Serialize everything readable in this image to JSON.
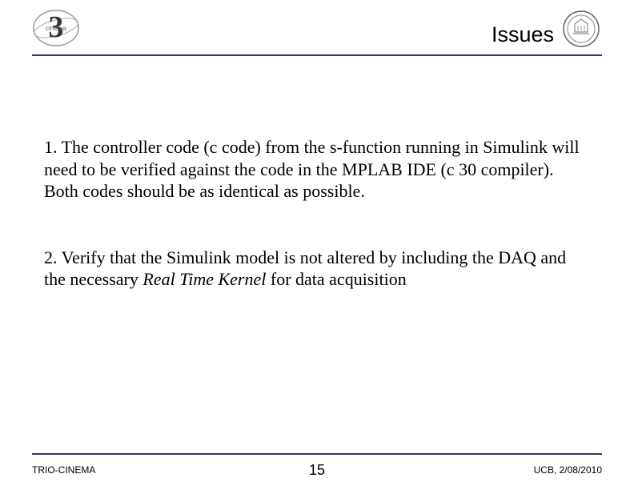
{
  "header": {
    "title": "Issues"
  },
  "content": {
    "para1_prefix": "1. The controller code (c code) from the s-function running in Simulink will need to be verified against the code in the MPLAB IDE (c 30 compiler). Both codes should be as identical as possible.",
    "para2_prefix": "2. Verify that the Simulink model is not altered by including the DAQ and the necessary ",
    "para2_italic": "Real Time Kernel",
    "para2_suffix": " for data acquisition"
  },
  "footer": {
    "left": "TRIO-CINEMA",
    "center": "15",
    "right": "UCB, 2/08/2010"
  }
}
